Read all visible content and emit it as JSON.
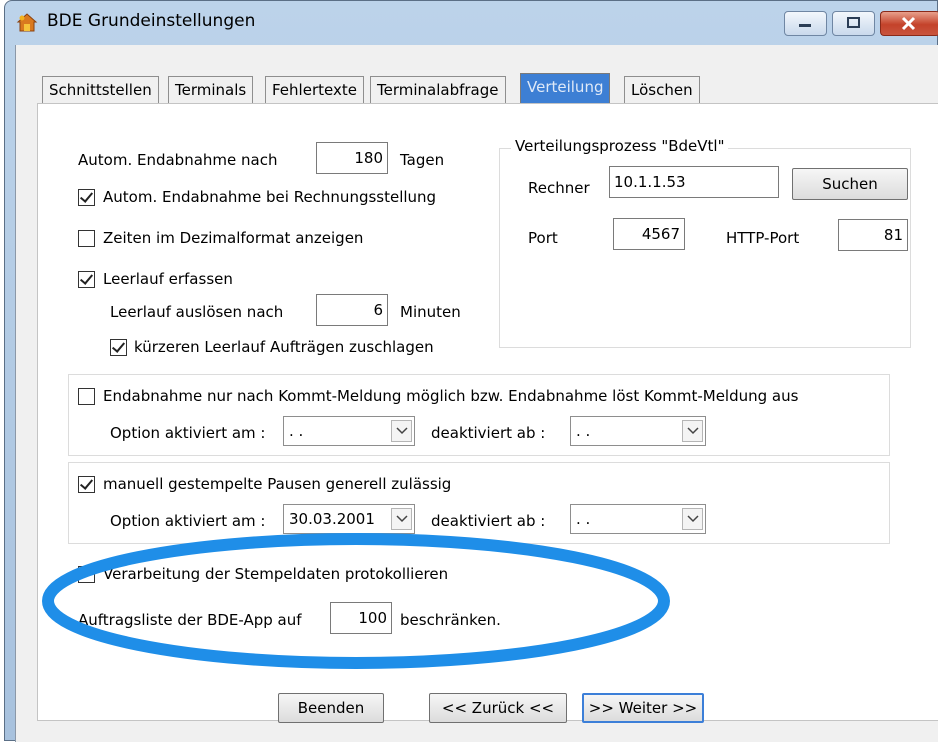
{
  "window": {
    "title": "BDE Grundeinstellungen",
    "accent_color": "#3d7fd4",
    "highlight_color": "#1f8ee8"
  },
  "tabs": [
    {
      "label": "Schnittstellen",
      "active": false
    },
    {
      "label": "Terminals",
      "active": false
    },
    {
      "label": "Fehlertexte",
      "active": false
    },
    {
      "label": "Terminalabfrage",
      "active": false
    },
    {
      "label": "Verteilung",
      "active": true
    },
    {
      "label": "Löschen",
      "active": false
    }
  ],
  "endabnahme": {
    "label": "Autom. Endabnahme nach",
    "days_value": "180",
    "days_unit": "Tagen",
    "rechnung_label": "Autom. Endabnahme bei Rechnungsstellung",
    "rechnung_checked": true
  },
  "dezimal": {
    "label": "Zeiten im Dezimalformat anzeigen",
    "checked": false
  },
  "leerlauf": {
    "label": "Leerlauf erfassen",
    "checked": true,
    "ausloesen_label": "Leerlauf auslösen nach",
    "ausloesen_value": "6",
    "ausloesen_unit": "Minuten",
    "kuerzer_label": "kürzeren Leerlauf Aufträgen zuschlagen",
    "kuerzer_checked": true
  },
  "verteilung": {
    "group_label": "Verteilungsprozess \"BdeVtl\"",
    "rechner_label": "Rechner",
    "rechner_value": "10.1.1.53",
    "suchen_label": "Suchen",
    "port_label": "Port",
    "port_value": "4567",
    "http_port_label": "HTTP-Port",
    "http_port_value": "81"
  },
  "kommt": {
    "label": "Endabnahme nur nach Kommt-Meldung möglich bzw. Endabnahme löst Kommt-Meldung aus",
    "checked": false,
    "aktiviert_label": "Option aktiviert am :",
    "aktiviert_value": ". .",
    "deaktiviert_label": "deaktiviert ab :",
    "deaktiviert_value": ". ."
  },
  "pausen": {
    "label": "manuell gestempelte Pausen generell zulässig",
    "checked": true,
    "aktiviert_label": "Option aktiviert am :",
    "aktiviert_value": "30.03.2001",
    "deaktiviert_label": "deaktiviert ab :",
    "deaktiviert_value": ". ."
  },
  "verarbeitung": {
    "label": "Verarbeitung der Stempeldaten protokollieren",
    "checked": false
  },
  "auftragsliste": {
    "prefix": "Auftragsliste der BDE-App auf",
    "value": "100",
    "suffix": "beschränken."
  },
  "footer": {
    "beenden": "Beenden",
    "zurueck": "<< Zurück <<",
    "weiter": ">> Weiter >>"
  }
}
